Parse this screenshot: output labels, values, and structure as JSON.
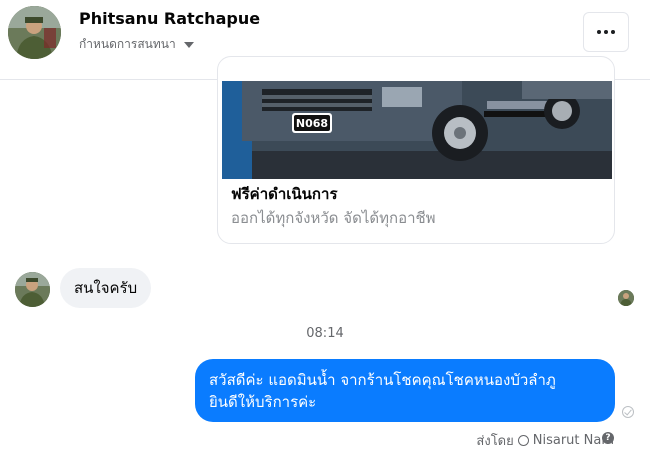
{
  "header": {
    "contact_name": "Phitsanu Ratchapue",
    "thread_settings_label": "กำหนดการสนทนา",
    "more_options_icon": "more-dots-icon"
  },
  "link_card": {
    "plate_text": "N068",
    "title": "ฟรีค่าดำเนินการ",
    "subtitle": "ออกได้ทุกจังหวัด จัดได้ทุกอาชีพ"
  },
  "messages": {
    "incoming": {
      "text": "สนใจครับ"
    },
    "timestamp": "08:14",
    "outgoing": {
      "line1": "สวัสดีค่ะ แอดมินน้ำ จากร้านโชคคุณโชคหนองบัวลำภู",
      "line2": "ยินดีให้บริการค่ะ"
    },
    "sent_by": {
      "prefix": "ส่งโดย",
      "name": "Nisarut Nam"
    }
  },
  "colors": {
    "outgoing_bubble": "#0a7cff",
    "incoming_bubble": "#f0f2f5",
    "secondary_text": "#65676b"
  }
}
